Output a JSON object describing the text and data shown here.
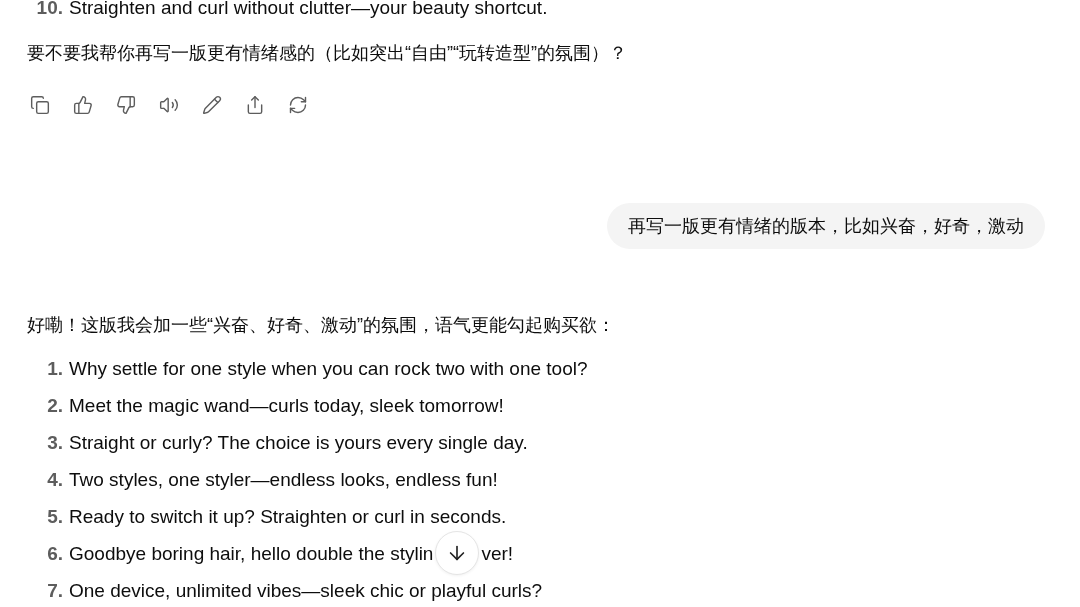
{
  "previous_items": [
    {
      "number": "10.",
      "text": "Straighten and curl without clutter—your beauty shortcut."
    }
  ],
  "assistant_question": "要不要我帮你再写一版更有情绪感的（比如突出“自由”“玩转造型”的氛围）？",
  "action_icons": [
    {
      "kind": "copy"
    },
    {
      "kind": "thumbs-up"
    },
    {
      "kind": "thumbs-down"
    },
    {
      "kind": "speaker"
    },
    {
      "kind": "edit"
    },
    {
      "kind": "share"
    },
    {
      "kind": "regenerate"
    }
  ],
  "user_message": "再写一版更有情绪的版本，比如兴奋，好奇，激动",
  "assistant_intro": "好嘞！这版我会加一些“兴奋、好奇、激动”的氛围，语气更能勾起购买欲：",
  "items": [
    {
      "number": "1.",
      "text": "Why settle for one style when you can rock two with one tool?"
    },
    {
      "number": "2.",
      "text": "Meet the magic wand—curls today, sleek tomorrow!"
    },
    {
      "number": "3.",
      "text": "Straight or curly? The choice is yours every single day."
    },
    {
      "number": "4.",
      "text": "Two styles, one styler—endless looks, endless fun!"
    },
    {
      "number": "5.",
      "text": "Ready to switch it up? Straighten or curl in seconds."
    },
    {
      "number": "6.",
      "text": "Goodbye boring hair, hello double the stylin",
      "text_after_overlay": "ver!",
      "scroll_button": true
    },
    {
      "number": "7.",
      "text": "One device, unlimited vibes—sleek chic or playful curls?"
    }
  ]
}
